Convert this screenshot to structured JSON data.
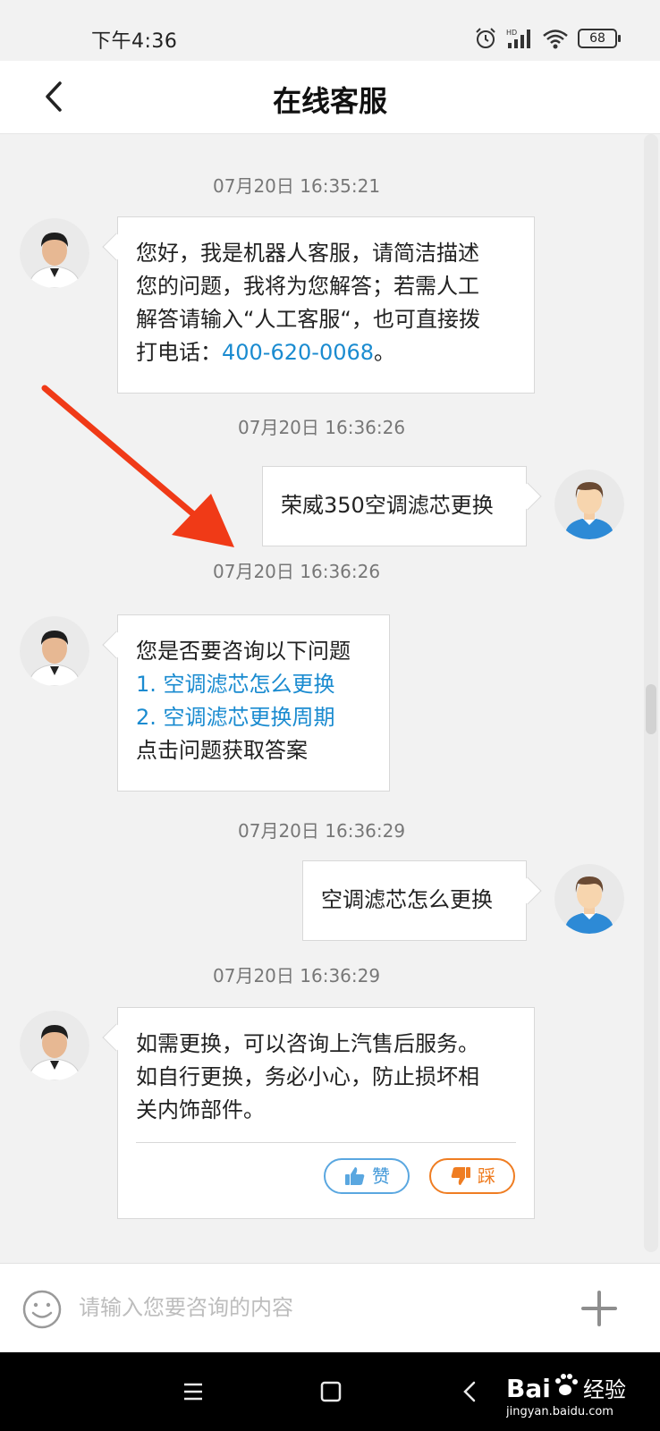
{
  "status_bar": {
    "time": "下午4:36",
    "hd_label": "HD",
    "battery": "68",
    "icons": [
      "alarm-icon",
      "cell-signal-icon",
      "wifi-icon",
      "battery-icon"
    ]
  },
  "header": {
    "title": "在线客服",
    "back_icon": "chevron-left-icon"
  },
  "messages": [
    {
      "timestamp": "07月20日 16:35:21"
    },
    {
      "lines": [
        "您好，我是机器人客服，请简洁描述",
        "您的问题，我将为您解答；若需人工",
        "解答请输入“人工客服“，也可直接拨"
      ],
      "phone_prefix": "打电话：",
      "phone": "400-620-0068",
      "phone_suffix": "。"
    },
    {
      "timestamp": "07月20日 16:36:26",
      "text": "荣威350空调滤芯更换"
    },
    {
      "timestamp": "07月20日 16:36:26",
      "intro": "您是否要咨询以下问题",
      "options": [
        "1. 空调滤芯怎么更换",
        "2. 空调滤芯更换周期"
      ],
      "footer": "点击问题获取答案"
    },
    {
      "timestamp": "07月20日 16:36:29",
      "text": "空调滤芯怎么更换"
    },
    {
      "timestamp": "07月20日 16:36:29",
      "lines": [
        "如需更换，可以咨询上汽售后服务。",
        "如自行更换，务必小心，防止损坏相",
        "关内饰部件。"
      ],
      "like_label": "赞",
      "dislike_label": "踩"
    }
  ],
  "input": {
    "placeholder": "请输入您要咨询的内容",
    "emoji_icon": "smiley-icon",
    "plus_icon": "plus-icon"
  },
  "colors": {
    "link": "#1a8bd0",
    "like": "#3f97d8",
    "dislike": "#ef7d22",
    "annotation_arrow": "#f03a17",
    "background": "#f2f2f2"
  },
  "watermark": {
    "brand": "Bai",
    "brand_suffix": "经验",
    "domain": "jingyan.baidu.com"
  }
}
